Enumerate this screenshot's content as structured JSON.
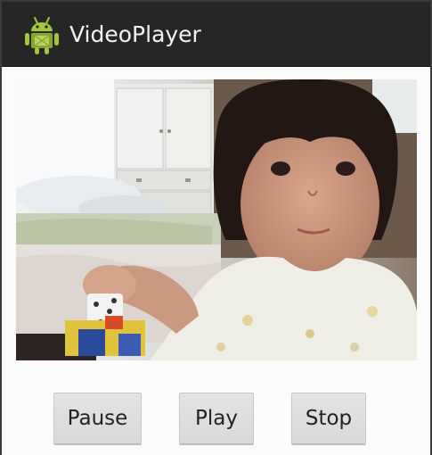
{
  "app": {
    "title": "VideoPlayer",
    "icon": "android-icon"
  },
  "video": {
    "content": "video-frame",
    "state": "playing"
  },
  "controls": {
    "pause_label": "Pause",
    "play_label": "Play",
    "stop_label": "Stop"
  },
  "colors": {
    "action_bar": "#262626",
    "android_green": "#a4c639",
    "button_bg": "#dedede",
    "background": "#fbfbfb"
  }
}
